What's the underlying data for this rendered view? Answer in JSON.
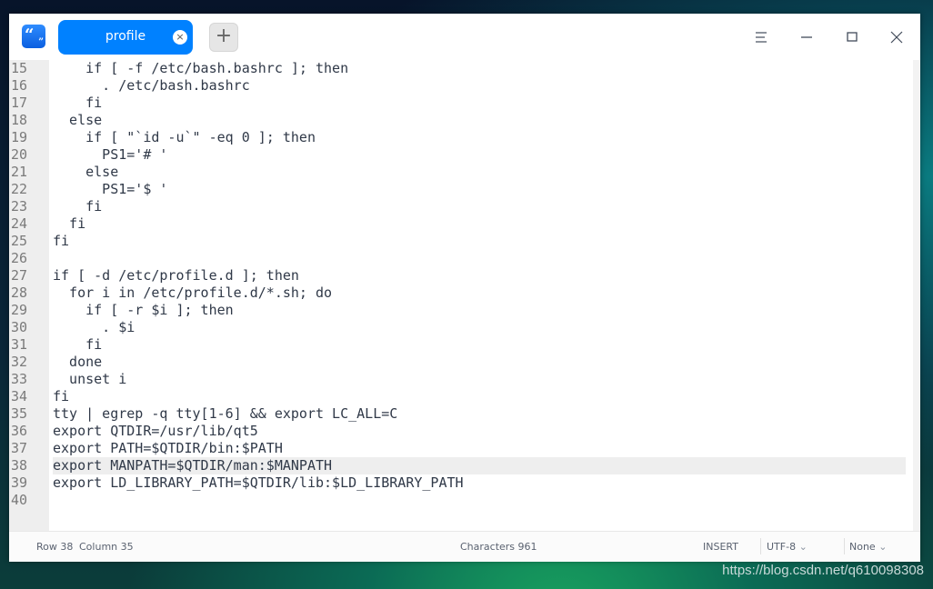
{
  "titlebar": {
    "app_icon": "text-editor-icon",
    "tab": {
      "label": "profile",
      "close_icon": "close-icon"
    },
    "add_tab_label": "+",
    "controls": [
      "menu-icon",
      "minimize-icon",
      "maximize-icon",
      "close-icon"
    ]
  },
  "editor": {
    "current_line": 38,
    "lines": [
      {
        "n": "15",
        "t": "    if [ -f /etc/bash.bashrc ]; then"
      },
      {
        "n": "16",
        "t": "      . /etc/bash.bashrc"
      },
      {
        "n": "17",
        "t": "    fi"
      },
      {
        "n": "18",
        "t": "  else"
      },
      {
        "n": "19",
        "t": "    if [ \"`id -u`\" -eq 0 ]; then"
      },
      {
        "n": "20",
        "t": "      PS1='# '"
      },
      {
        "n": "21",
        "t": "    else"
      },
      {
        "n": "22",
        "t": "      PS1='$ '"
      },
      {
        "n": "23",
        "t": "    fi"
      },
      {
        "n": "24",
        "t": "  fi"
      },
      {
        "n": "25",
        "t": "fi"
      },
      {
        "n": "26",
        "t": ""
      },
      {
        "n": "27",
        "t": "if [ -d /etc/profile.d ]; then"
      },
      {
        "n": "28",
        "t": "  for i in /etc/profile.d/*.sh; do"
      },
      {
        "n": "29",
        "t": "    if [ -r $i ]; then"
      },
      {
        "n": "30",
        "t": "      . $i"
      },
      {
        "n": "31",
        "t": "    fi"
      },
      {
        "n": "32",
        "t": "  done"
      },
      {
        "n": "33",
        "t": "  unset i"
      },
      {
        "n": "34",
        "t": "fi"
      },
      {
        "n": "35",
        "t": "tty | egrep -q tty[1-6] && export LC_ALL=C"
      },
      {
        "n": "36",
        "t": "export QTDIR=/usr/lib/qt5"
      },
      {
        "n": "37",
        "t": "export PATH=$QTDIR/bin:$PATH"
      },
      {
        "n": "38",
        "t": "export MANPATH=$QTDIR/man:$MANPATH"
      },
      {
        "n": "39",
        "t": "export LD_LIBRARY_PATH=$QTDIR/lib:$LD_LIBRARY_PATH"
      },
      {
        "n": "40",
        "t": ""
      }
    ]
  },
  "statusbar": {
    "row_label": "Row 38",
    "column_label": "Column 35",
    "characters_label": "Characters 961",
    "mode": "INSERT",
    "encoding": "UTF-8",
    "highlight": "None"
  },
  "watermark": "https://blog.csdn.net/q610098308",
  "colors": {
    "accent": "#0081ff",
    "code_text": "#303948",
    "gutter": "#eeeeee"
  }
}
